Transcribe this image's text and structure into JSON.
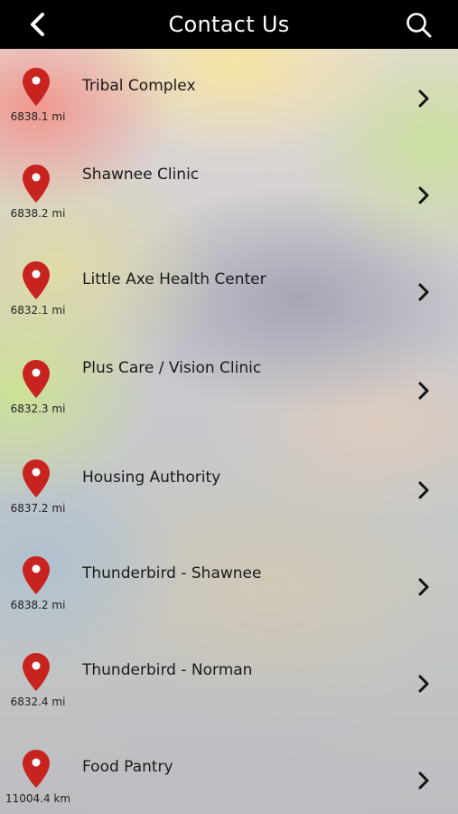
{
  "header": {
    "title": "Contact Us",
    "back_icon": "chevron-left-icon",
    "search_icon": "search-icon"
  },
  "colors": {
    "header_bg": "#000000",
    "pin": "#c8241f",
    "text": "#1a1a1a"
  },
  "locations": [
    {
      "name": "Tribal Complex",
      "distance": "6838.1 mi"
    },
    {
      "name": "Shawnee Clinic",
      "distance": "6838.2 mi"
    },
    {
      "name": "Little Axe Health Center",
      "distance": "6832.1 mi"
    },
    {
      "name": "Plus Care / Vision Clinic",
      "distance": "6832.3 mi"
    },
    {
      "name": "Housing Authority",
      "distance": "6837.2 mi"
    },
    {
      "name": "Thunderbird - Shawnee",
      "distance": "6838.2 mi"
    },
    {
      "name": "Thunderbird - Norman",
      "distance": "6832.4 mi"
    },
    {
      "name": "Food Pantry",
      "distance": "11004.4 km"
    }
  ]
}
